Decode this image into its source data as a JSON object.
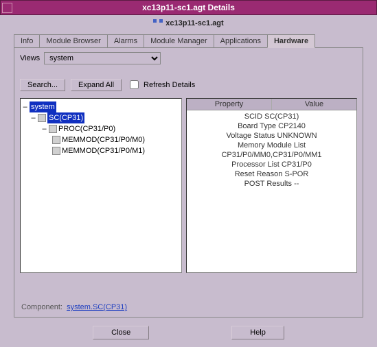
{
  "window": {
    "title": "xc13p11-sc1.agt Details",
    "subtitle": "xc13p11-sc1.agt"
  },
  "tabs": {
    "items": [
      {
        "label": "Info",
        "active": false
      },
      {
        "label": "Module Browser",
        "active": false
      },
      {
        "label": "Alarms",
        "active": false
      },
      {
        "label": "Module Manager",
        "active": false
      },
      {
        "label": "Applications",
        "active": false
      },
      {
        "label": "Hardware",
        "active": true
      }
    ]
  },
  "views": {
    "label": "Views",
    "selected": "system"
  },
  "toolbar": {
    "search": "Search...",
    "expand": "Expand All",
    "refresh": "Refresh Details"
  },
  "tree": {
    "root": "system",
    "selected": "SC(CP31)",
    "proc": "PROC(CP31/P0)",
    "mem0": "MEMMOD(CP31/P0/M0)",
    "mem1": "MEMMOD(CP31/P0/M1)"
  },
  "properties": {
    "header_property": "Property",
    "header_value": "Value",
    "rows": [
      "SCID SC(CP31)",
      "Board Type CP2140",
      "Voltage Status UNKNOWN",
      "Memory Module List CP31/P0/MM0,CP31/P0/MM1",
      "Processor List CP31/P0",
      "Reset Reason S-POR",
      "POST Results --"
    ]
  },
  "component": {
    "label": "Component:",
    "value": "system.SC(CP31)"
  },
  "buttons": {
    "close": "Close",
    "help": "Help"
  }
}
